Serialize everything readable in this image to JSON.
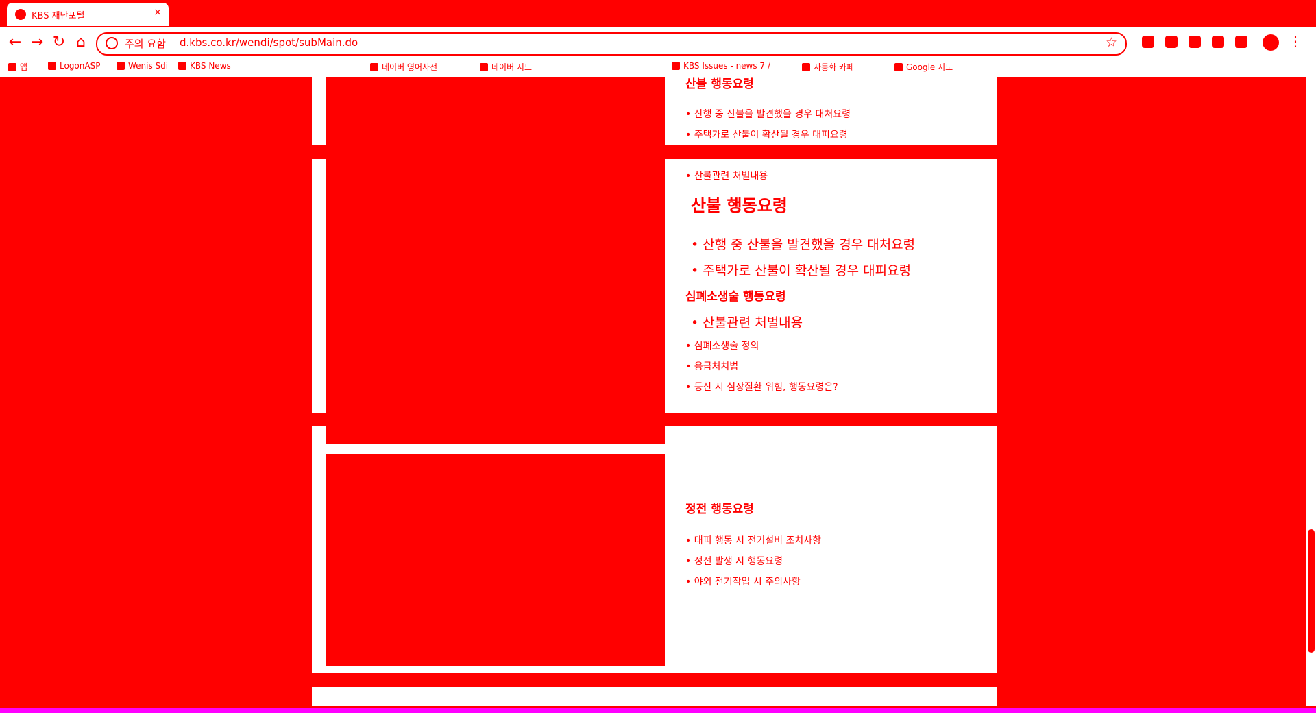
{
  "browser": {
    "tab_title": "KBS 재난포털",
    "close_glyph": "×",
    "security_label": "주의 요함",
    "url": "d.kbs.co.kr/wendi/spot/subMain.do",
    "bookmarks": [
      {
        "label": "앱"
      },
      {
        "label": "LogonASP"
      },
      {
        "label": "Wenis Sdi"
      },
      {
        "label": "KBS News"
      },
      {
        "label": "네이버 영어사전"
      },
      {
        "label": "네이버 지도"
      },
      {
        "label": "KBS Issues - news 7 /"
      },
      {
        "label": "자동화 카페"
      },
      {
        "label": "Google 지도"
      }
    ]
  },
  "sections": [
    {
      "title": "산불 행동요령",
      "items": [
        "산행 중 산불을 발견했을 경우 대처요령",
        "주택가로 산불이 확산될 경우 대피요령",
        "산불관련 처벌내용"
      ]
    },
    {
      "title": "산불 행동요령",
      "items": [
        "산행 중 산불을 발견했을 경우 대처요령",
        "주택가로 산불이 확산될 경우 대피요령",
        "산불관련 처벌내용"
      ]
    },
    {
      "title": "심폐소생술 행동요령",
      "items": [
        "심폐소생술 정의",
        "응급처치법",
        "등산 시 심장질환 위험, 행동요령은?"
      ]
    },
    {
      "title": "정전 행동요령",
      "items": [
        "대피 행동 시 전기설비 조치사항",
        "정전 발생 시 행동요령",
        "야외 전기작업 시 주의사항"
      ]
    }
  ]
}
